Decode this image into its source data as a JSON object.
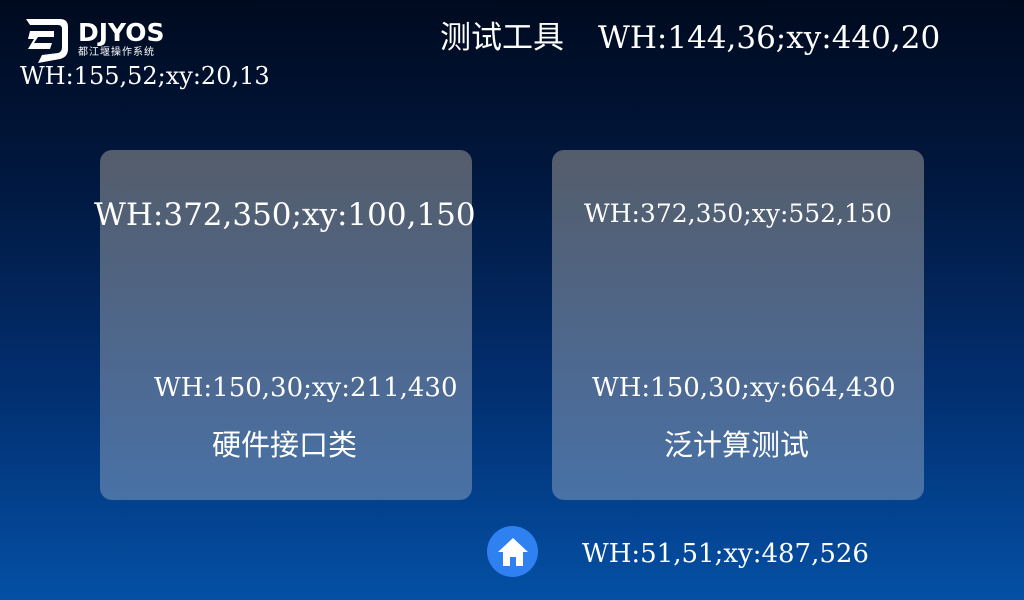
{
  "logo": {
    "brand": "DJYOS",
    "subtitle": "都江堰操作系统",
    "annotation": "WH:155,52;xy:20,13"
  },
  "header": {
    "title": "测试工具",
    "annotation": "WH:144,36;xy:440,20"
  },
  "cards": [
    {
      "annotation": "WH:372,350;xy:100,150",
      "label": "硬件接口类",
      "label_annotation": "WH:150,30;xy:211,430"
    },
    {
      "annotation": "WH:372,350;xy:552,150",
      "label": "泛计算测试",
      "label_annotation": "WH:150,30;xy:664,430"
    }
  ],
  "home": {
    "icon": "home-icon",
    "annotation": "WH:51,51;xy:487,526"
  },
  "colors": {
    "home_button": "#2f80f0",
    "background_top": "#000a1f",
    "background_bottom": "#0450a5"
  }
}
